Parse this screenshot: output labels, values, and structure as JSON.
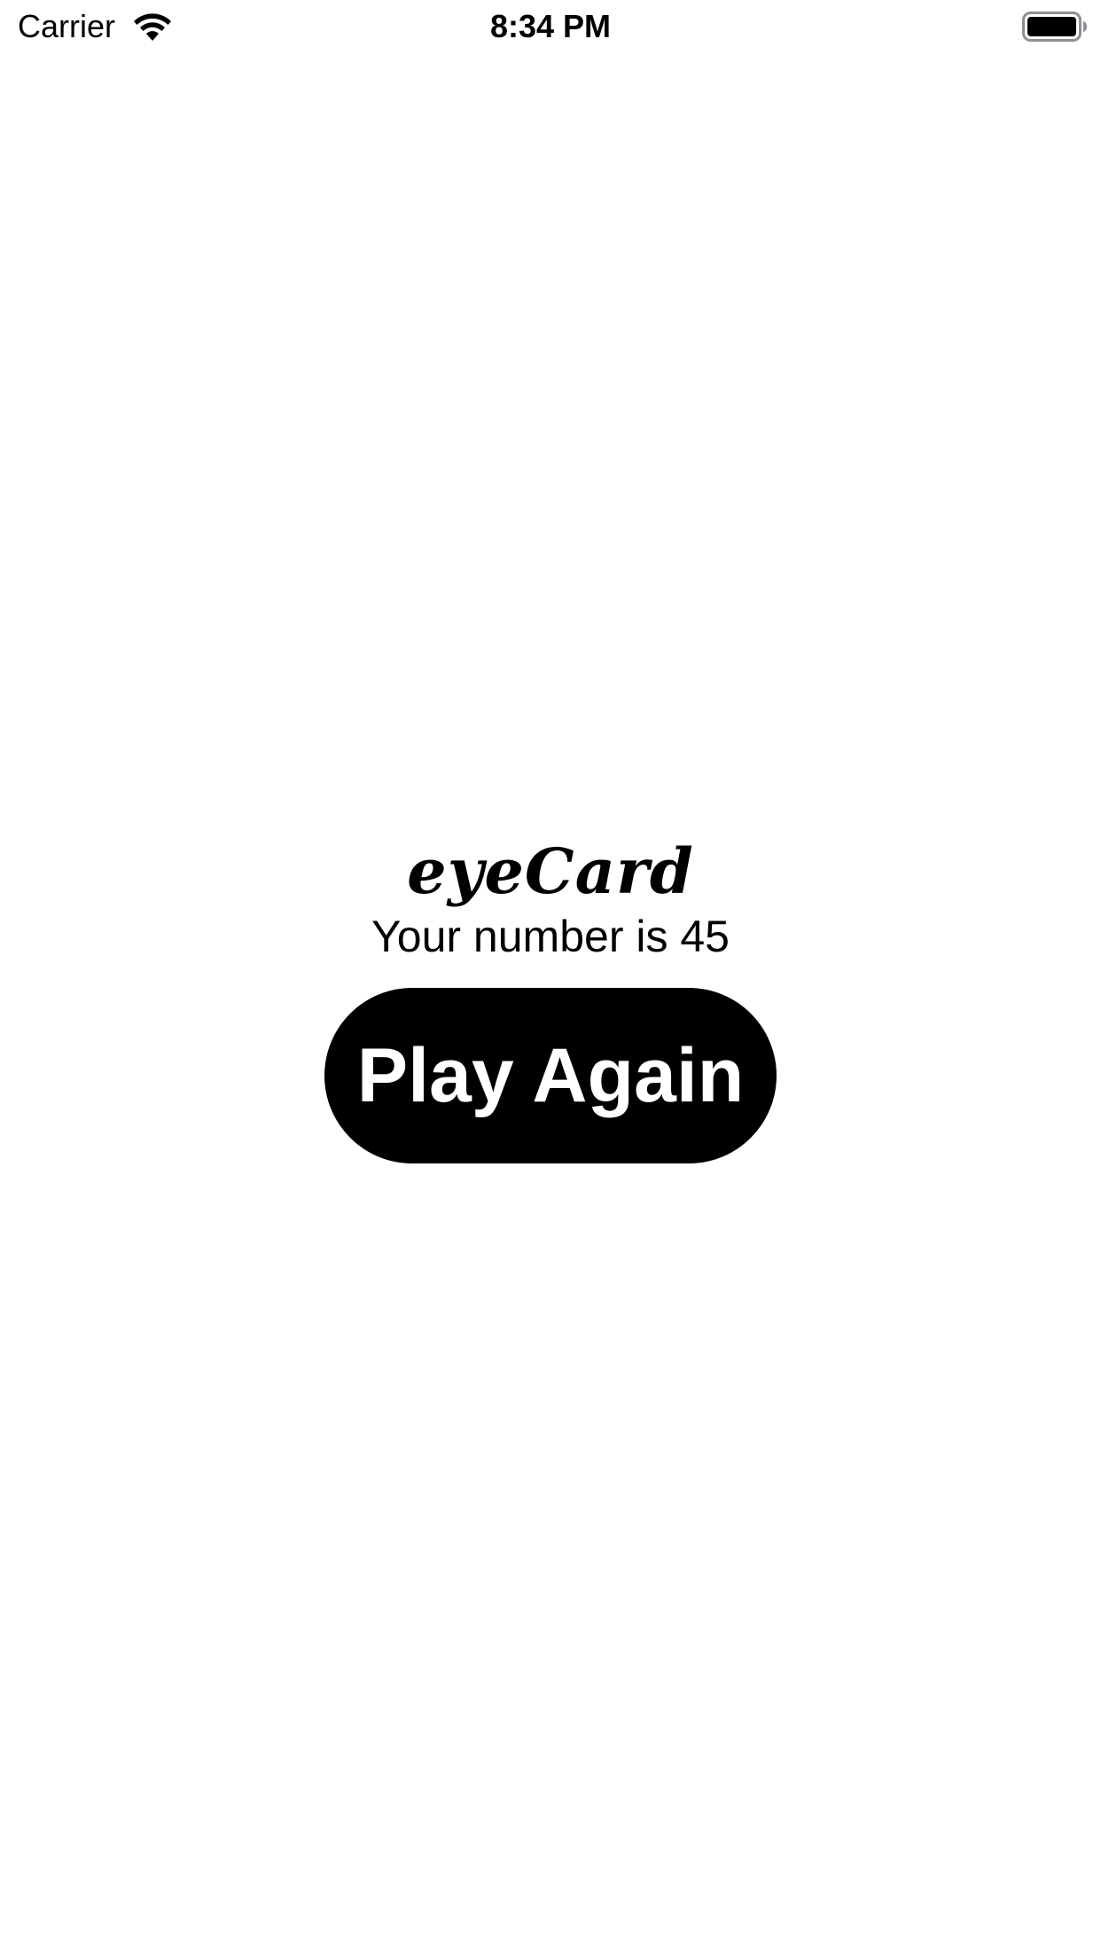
{
  "status_bar": {
    "carrier": "Carrier",
    "time": "8:34 PM",
    "wifi_icon": "wifi-icon",
    "battery_icon": "battery-icon"
  },
  "main": {
    "app_title": "eyeCard",
    "result_text": "Your number is 45",
    "play_again_label": "Play Again"
  },
  "colors": {
    "background": "#ffffff",
    "button_background": "#000000",
    "button_text": "#ffffff",
    "text": "#000000"
  }
}
